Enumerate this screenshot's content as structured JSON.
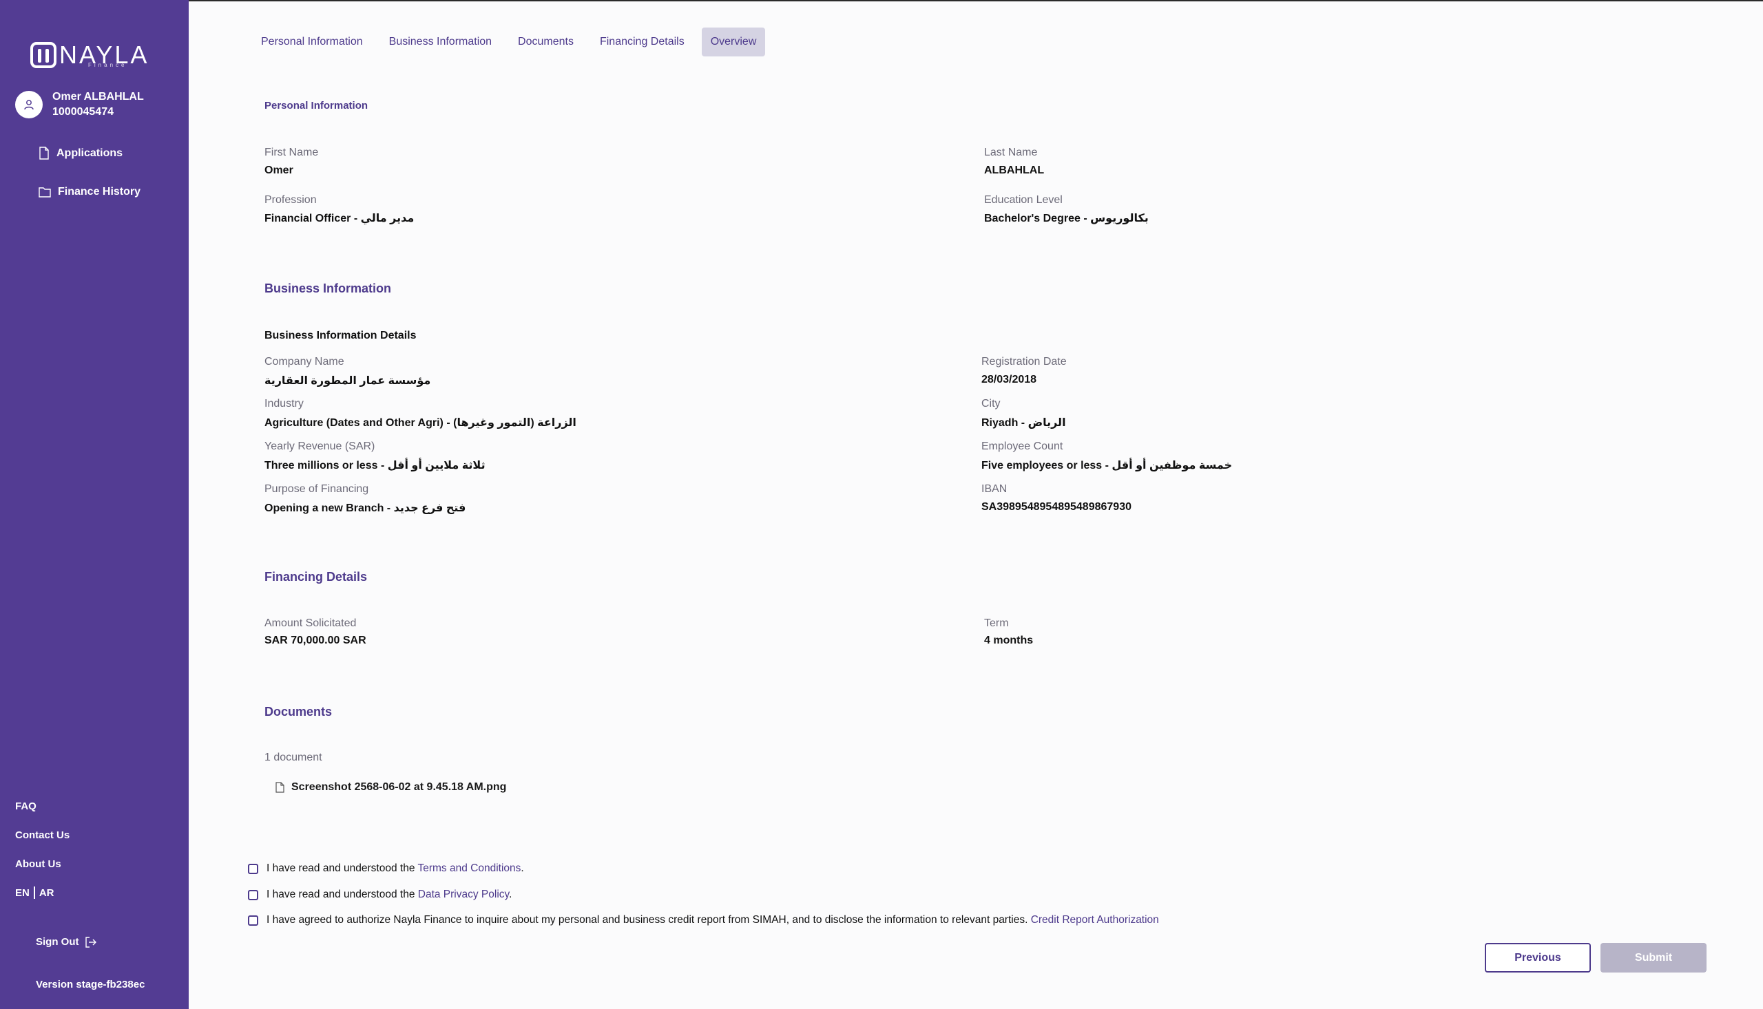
{
  "brand": {
    "logo_text": "NAYLA",
    "logo_sub": "Finance"
  },
  "user": {
    "name": "Omer ALBAHLAL",
    "id": "1000045474"
  },
  "sidebar": {
    "items": [
      {
        "label": "Applications",
        "icon": "document-icon"
      },
      {
        "label": "Finance History",
        "icon": "folder-icon"
      }
    ],
    "faq": "FAQ",
    "contact": "Contact Us",
    "about": "About Us",
    "lang_en": "EN",
    "lang_ar": "AR",
    "sign_out": "Sign Out",
    "version": "Version stage-fb238ec"
  },
  "tabs": [
    {
      "label": "Personal Information",
      "active": false
    },
    {
      "label": "Business Information",
      "active": false
    },
    {
      "label": "Documents",
      "active": false
    },
    {
      "label": "Financing Details",
      "active": false
    },
    {
      "label": "Overview",
      "active": true
    }
  ],
  "personal": {
    "title": "Personal Information",
    "first_name_label": "First Name",
    "first_name": "Omer",
    "last_name_label": "Last Name",
    "last_name": "ALBAHLAL",
    "profession_label": "Profession",
    "profession": "Financial Officer - مدير مالي",
    "education_label": "Education Level",
    "education": "Bachelor's Degree - بكالوريوس"
  },
  "business": {
    "title": "Business Information",
    "details_title": "Business Information Details",
    "company_label": "Company Name",
    "company": "مؤسسة عمار المطورة العقارية",
    "reg_date_label": "Registration Date",
    "reg_date": "28/03/2018",
    "industry_label": "Industry",
    "industry": "Agriculture (Dates and Other Agri) - الزراعة (التمور وغيرها)",
    "city_label": "City",
    "city": "Riyadh - الرياض",
    "revenue_label": "Yearly Revenue (SAR)",
    "revenue": "Three millions or less - ثلاثة ملايين أو أقل",
    "employees_label": "Employee Count",
    "employees": "Five employees or less - خمسة موظفين أو أقل",
    "purpose_label": "Purpose of Financing",
    "purpose": "Opening a new Branch - فتح فرع جديد",
    "iban_label": "IBAN",
    "iban": "SA3989548954895489867930"
  },
  "financing": {
    "title": "Financing Details",
    "amount_label": "Amount Solicitated",
    "amount": "SAR 70,000.00 SAR",
    "term_label": "Term",
    "term": "4 months"
  },
  "documents": {
    "title": "Documents",
    "count": "1 document",
    "files": [
      "Screenshot 2568-06-02 at 9.45.18 AM.png"
    ]
  },
  "agreements": {
    "terms_prefix": "I have read and understood the ",
    "terms_link": "Terms and Conditions",
    "privacy_prefix": "I have read and understood the ",
    "privacy_link": "Data Privacy Policy",
    "period": ".",
    "credit_text": "I have agreed to authorize Nayla Finance to inquire about my personal and business credit report from SIMAH, and to disclose the information to relevant parties. ",
    "credit_link": "Credit Report Authorization"
  },
  "buttons": {
    "previous": "Previous",
    "submit": "Submit"
  },
  "colors": {
    "sidebar": "#533c93",
    "accent": "#4d3a8c",
    "disabled": "#b7b4c8"
  }
}
